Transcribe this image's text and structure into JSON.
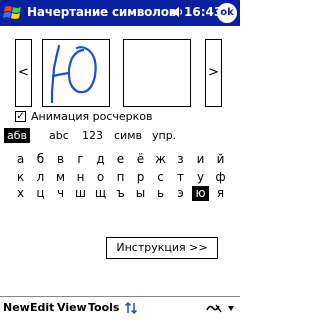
{
  "title_bar": {
    "title": "Начертание символов",
    "time": "16:43",
    "ok_label": "ok"
  },
  "preview": {
    "prev_label": "<",
    "next_label": ">"
  },
  "animation": {
    "checkbox_mark": "✓",
    "label": "Анимация росчерков"
  },
  "tabs": [
    {
      "label": "абв",
      "selected": true
    },
    {
      "label": "abc",
      "selected": false
    },
    {
      "label": "123",
      "selected": false
    },
    {
      "label": "симв",
      "selected": false
    },
    {
      "label": "упр.",
      "selected": false
    }
  ],
  "letters": [
    [
      "а",
      "б",
      "в",
      "г",
      "д",
      "е",
      "ё",
      "ж",
      "з",
      "и",
      "й"
    ],
    [
      "к",
      "л",
      "м",
      "н",
      "о",
      "п",
      "р",
      "с",
      "т",
      "у",
      "ф"
    ],
    [
      "х",
      "ц",
      "ч",
      "ш",
      "щ",
      "ъ",
      "ы",
      "ь",
      "э",
      "ю",
      "я"
    ]
  ],
  "selected_letter": "ю",
  "instruction_button": "Инструкция >>",
  "menu": {
    "new": "New",
    "edit": "Edit",
    "view": "View",
    "tools": "Tools"
  },
  "colors": {
    "title_bar": "#0a1f9e",
    "accent_blue": "#1a4fd0"
  }
}
